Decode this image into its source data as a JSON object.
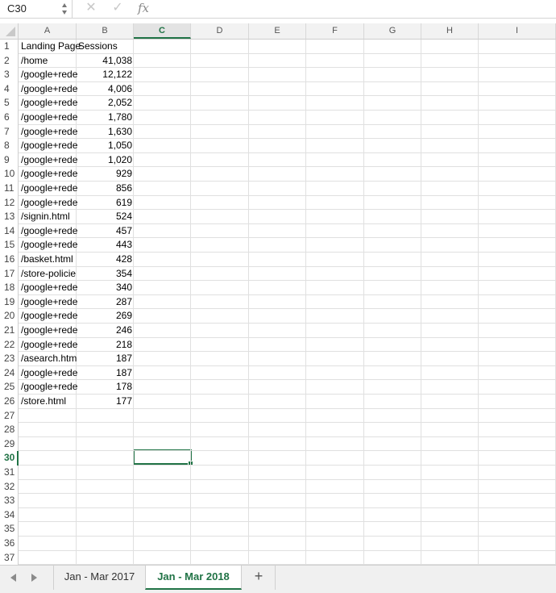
{
  "formula_bar": {
    "name_box": "C30",
    "cancel_icon": "✕",
    "enter_icon": "✓",
    "fx_label": "fx",
    "formula_value": ""
  },
  "columns": [
    "A",
    "B",
    "C",
    "D",
    "E",
    "F",
    "G",
    "H",
    "I"
  ],
  "selected_column": "C",
  "row_numbers": [
    "1",
    "2",
    "3",
    "4",
    "5",
    "6",
    "7",
    "8",
    "9",
    "10",
    "11",
    "12",
    "13",
    "14",
    "15",
    "16",
    "17",
    "18",
    "19",
    "20",
    "21",
    "22",
    "23",
    "24",
    "25",
    "26",
    "27",
    "28",
    "29",
    "30",
    "31",
    "32",
    "33",
    "34",
    "35",
    "36",
    "37"
  ],
  "selected_row": "30",
  "sheet": {
    "header": [
      "Landing Page",
      "Sessions"
    ],
    "rows": [
      [
        "/home",
        "41,038"
      ],
      [
        "/google+rede",
        "12,122"
      ],
      [
        "/google+rede",
        "4,006"
      ],
      [
        "/google+rede",
        "2,052"
      ],
      [
        "/google+rede",
        "1,780"
      ],
      [
        "/google+rede",
        "1,630"
      ],
      [
        "/google+rede",
        "1,050"
      ],
      [
        "/google+rede",
        "1,020"
      ],
      [
        "/google+rede",
        "929"
      ],
      [
        "/google+rede",
        "856"
      ],
      [
        "/google+rede",
        "619"
      ],
      [
        "/signin.html",
        "524"
      ],
      [
        "/google+rede",
        "457"
      ],
      [
        "/google+rede",
        "443"
      ],
      [
        "/basket.html",
        "428"
      ],
      [
        "/store-policie",
        "354"
      ],
      [
        "/google+rede",
        "340"
      ],
      [
        "/google+rede",
        "287"
      ],
      [
        "/google+rede",
        "269"
      ],
      [
        "/google+rede",
        "246"
      ],
      [
        "/google+rede",
        "218"
      ],
      [
        "/asearch.htm",
        "187"
      ],
      [
        "/google+rede",
        "187"
      ],
      [
        "/google+rede",
        "178"
      ],
      [
        "/store.html",
        "177"
      ]
    ]
  },
  "tabs": {
    "items": [
      "Jan - Mar 2017",
      "Jan - Mar 2018"
    ],
    "active": "Jan - Mar 2018",
    "add_label": "+"
  },
  "colors": {
    "accent": "#217346",
    "gridline": "#e0e0e0",
    "header_bg": "#f2f2f2"
  }
}
